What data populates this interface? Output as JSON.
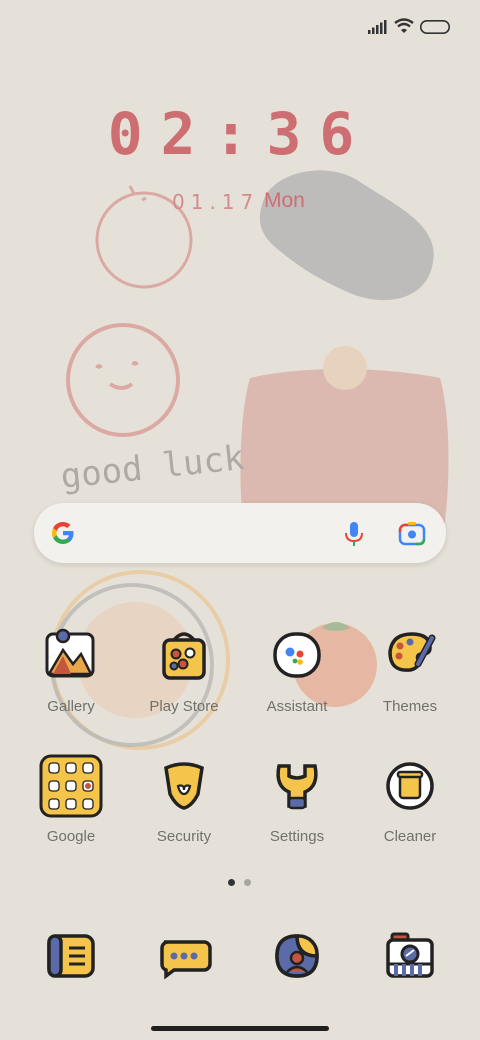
{
  "status_bar": {
    "icons": [
      "signal-icon",
      "wifi-icon",
      "battery-icon"
    ]
  },
  "clock": {
    "time": "02:36",
    "date": "01.17",
    "weekday": "Mon"
  },
  "wallpaper": {
    "doodle_text": "good luck"
  },
  "search_bar": {
    "icons": [
      "google-g-icon",
      "microphone-icon",
      "lens-camera-icon"
    ]
  },
  "apps": [
    {
      "label": "Gallery",
      "icon": "gallery-icon"
    },
    {
      "label": "Play Store",
      "icon": "play-store-icon"
    },
    {
      "label": "Assistant",
      "icon": "assistant-icon"
    },
    {
      "label": "Themes",
      "icon": "themes-icon"
    },
    {
      "label": "Google",
      "icon": "google-folder-icon"
    },
    {
      "label": "Security",
      "icon": "security-icon"
    },
    {
      "label": "Settings",
      "icon": "settings-icon"
    },
    {
      "label": "Cleaner",
      "icon": "cleaner-icon"
    }
  ],
  "page_indicator": {
    "pages": 2,
    "current": 1
  },
  "dock": [
    "phone-icon",
    "messages-icon",
    "contacts-icon",
    "camera-icon"
  ],
  "colors": {
    "background": "#e6e1d8",
    "clock": "#cd6e73",
    "label": "#727069"
  }
}
